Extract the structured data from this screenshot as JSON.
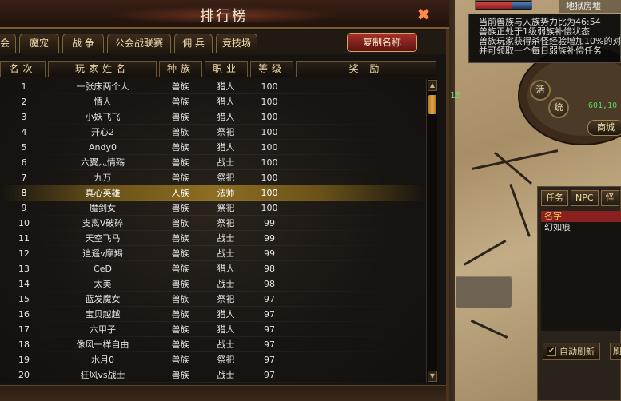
{
  "window": {
    "title": "排行榜",
    "close_label": "✖",
    "copy_button": "复制名称"
  },
  "tabs": [
    "会",
    "魔宠",
    "战 争",
    "公会战联赛",
    "佣 兵",
    "竞技场"
  ],
  "columns": {
    "rank": "名次",
    "name": "玩家姓名",
    "race": "种族",
    "job": "职业",
    "level": "等级",
    "reward": "奖 励"
  },
  "rows": [
    {
      "rank": "1",
      "name": "一张床两个人",
      "race": "兽族",
      "job": "猎人",
      "level": "100"
    },
    {
      "rank": "2",
      "name": "情人",
      "race": "兽族",
      "job": "猎人",
      "level": "100"
    },
    {
      "rank": "3",
      "name": "小妖飞飞",
      "race": "兽族",
      "job": "猎人",
      "level": "100"
    },
    {
      "rank": "4",
      "name": "开心2",
      "race": "兽族",
      "job": "祭祀",
      "level": "100"
    },
    {
      "rank": "5",
      "name": "Andy0",
      "race": "兽族",
      "job": "猎人",
      "level": "100"
    },
    {
      "rank": "6",
      "name": "六翼灬情殇",
      "race": "兽族",
      "job": "战士",
      "level": "100"
    },
    {
      "rank": "7",
      "name": "九万",
      "race": "兽族",
      "job": "祭祀",
      "level": "100"
    },
    {
      "rank": "8",
      "name": "真心英雄",
      "race": "人族",
      "job": "法师",
      "level": "100",
      "selected": true
    },
    {
      "rank": "9",
      "name": "魔剑女",
      "race": "兽族",
      "job": "祭祀",
      "level": "100"
    },
    {
      "rank": "10",
      "name": "支离V破碎",
      "race": "兽族",
      "job": "祭祀",
      "level": "99"
    },
    {
      "rank": "11",
      "name": "天空飞马",
      "race": "兽族",
      "job": "战士",
      "level": "99"
    },
    {
      "rank": "12",
      "name": "逍遥v摩羯",
      "race": "兽族",
      "job": "战士",
      "level": "99"
    },
    {
      "rank": "13",
      "name": "CeD",
      "race": "兽族",
      "job": "猎人",
      "level": "98"
    },
    {
      "rank": "14",
      "name": "太美",
      "race": "兽族",
      "job": "战士",
      "level": "98"
    },
    {
      "rank": "15",
      "name": "蓝发魔女",
      "race": "兽族",
      "job": "祭祀",
      "level": "97"
    },
    {
      "rank": "16",
      "name": "宝贝越越",
      "race": "兽族",
      "job": "猎人",
      "level": "97"
    },
    {
      "rank": "17",
      "name": "六甲子",
      "race": "兽族",
      "job": "猎人",
      "level": "97"
    },
    {
      "rank": "18",
      "name": "像风一样自由",
      "race": "兽族",
      "job": "战士",
      "level": "97"
    },
    {
      "rank": "19",
      "name": "水月0",
      "race": "兽族",
      "job": "祭祀",
      "level": "97"
    },
    {
      "rank": "20",
      "name": "狂风vs战士",
      "race": "兽族",
      "job": "战士",
      "level": "97"
    }
  ],
  "hud": {
    "map_name": "地狱房墟",
    "hp_fraction": 0.63,
    "side_number": "15",
    "coords": "601,10",
    "shop": "商城",
    "btn_a": "活",
    "btn_b": "统"
  },
  "tooltip": [
    "当前兽族与人族势力比为46:54",
    "兽族正处于1级弱族补偿状态",
    "兽族玩家获得杀怪经验增加10%的对",
    "并可领取一个每日弱族补偿任务"
  ],
  "quest_panel": {
    "tabs": [
      "任务",
      "NPC",
      "怪"
    ],
    "header": "名字",
    "item": "幻如痕",
    "auto_refresh": "自动刷新",
    "auto_refresh_checked": "✔",
    "refresh": "刷"
  },
  "colors": {
    "selected_row": "#8d6e22",
    "copy_button": "#a9302a",
    "quest_header": "#8a2020"
  }
}
